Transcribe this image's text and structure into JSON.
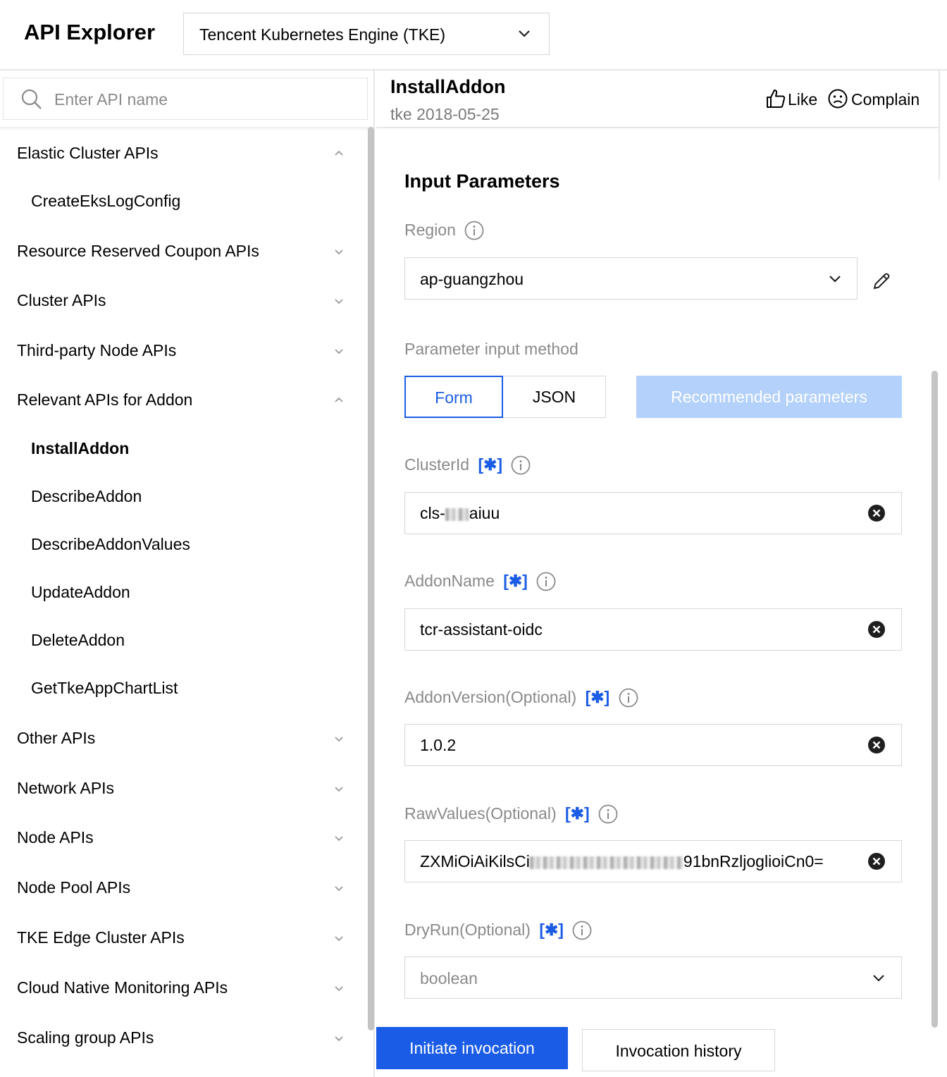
{
  "header": {
    "title": "API Explorer",
    "product_select": "Tencent Kubernetes Engine (TKE)"
  },
  "sidebar": {
    "search_placeholder": "Enter API name",
    "items": [
      {
        "label": "Elastic Cluster APIs",
        "level": 1,
        "expanded": true
      },
      {
        "label": "CreateEksLogConfig",
        "level": 2
      },
      {
        "label": "Resource Reserved Coupon APIs",
        "level": 1,
        "expanded": false
      },
      {
        "label": "Cluster APIs",
        "level": 1,
        "expanded": false
      },
      {
        "label": "Third-party Node APIs",
        "level": 1,
        "expanded": false
      },
      {
        "label": "Relevant APIs for Addon",
        "level": 1,
        "expanded": true
      },
      {
        "label": "InstallAddon",
        "level": 2,
        "active": true
      },
      {
        "label": "DescribeAddon",
        "level": 2
      },
      {
        "label": "DescribeAddonValues",
        "level": 2
      },
      {
        "label": "UpdateAddon",
        "level": 2
      },
      {
        "label": "DeleteAddon",
        "level": 2
      },
      {
        "label": "GetTkeAppChartList",
        "level": 2
      },
      {
        "label": "Other APIs",
        "level": 1,
        "expanded": false
      },
      {
        "label": "Network APIs",
        "level": 1,
        "expanded": false
      },
      {
        "label": "Node APIs",
        "level": 1,
        "expanded": false
      },
      {
        "label": "Node Pool APIs",
        "level": 1,
        "expanded": false
      },
      {
        "label": "TKE Edge Cluster APIs",
        "level": 1,
        "expanded": false
      },
      {
        "label": "Cloud Native Monitoring APIs",
        "level": 1,
        "expanded": false
      },
      {
        "label": "Scaling group APIs",
        "level": 1,
        "expanded": false
      }
    ]
  },
  "api": {
    "name": "InstallAddon",
    "version": "tke 2018-05-25",
    "like_label": "Like",
    "complain_label": "Complain"
  },
  "form": {
    "section_title": "Input Parameters",
    "region_label": "Region",
    "region_value": "ap-guangzhou",
    "method_label": "Parameter input method",
    "method_form": "Form",
    "method_json": "JSON",
    "method_selected": "Form",
    "recommended_label": "Recommended parameters",
    "required_marker": "[✱]",
    "cluster_id_label": "ClusterId",
    "cluster_id_prefix": "cls-",
    "cluster_id_suffix": "aiuu",
    "addon_name_label": "AddonName",
    "addon_name_value": "tcr-assistant-oidc",
    "addon_version_label": "AddonVersion(Optional)",
    "addon_version_value": "1.0.2",
    "raw_values_label": "RawValues(Optional)",
    "raw_values_prefix": "ZXMiOiAiKilsCi",
    "raw_values_suffix": "91bnRzljoglioiCn0=",
    "dry_run_label": "DryRun(Optional)",
    "dry_run_placeholder": "boolean"
  },
  "actions": {
    "invoke_label": "Initiate invocation",
    "history_label": "Invocation history"
  },
  "colors": {
    "accent": "#1a5ce5",
    "disabled_accent": "#b3d1fa",
    "muted_text": "#8a8a8a"
  }
}
